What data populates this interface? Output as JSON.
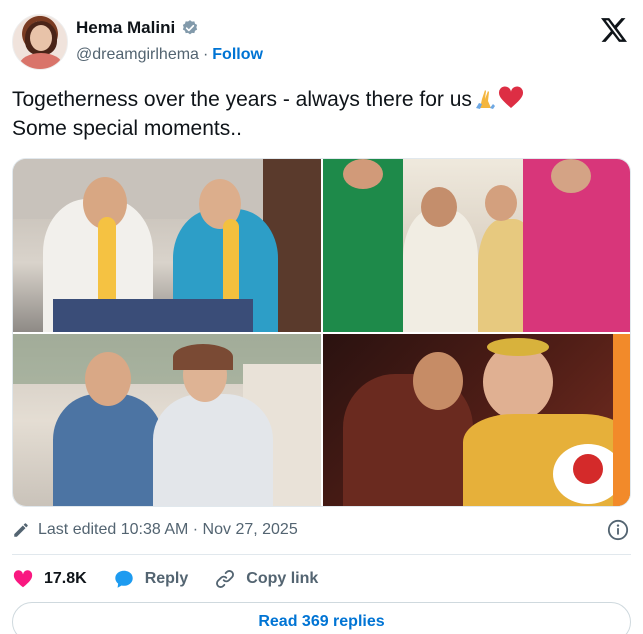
{
  "author": {
    "name": "Hema Malini",
    "handle": "@dreamgirlhema",
    "separator": "·",
    "follow_label": "Follow"
  },
  "tweet": {
    "text": "Togetherness over the years - always there for us",
    "text_line2": "Some special moments.."
  },
  "meta": {
    "edited_label": "Last edited 10:38 AM · Nov 27, 2025"
  },
  "actions": {
    "likes": "17.8K",
    "reply_label": "Reply",
    "copy_label": "Copy link"
  },
  "read_replies_label": "Read 369 replies",
  "icons": [
    "verified-badge-icon",
    "x-logo-icon",
    "folded-hands-icon",
    "red-heart-icon",
    "edit-pencil-icon",
    "info-icon",
    "heart-icon",
    "reply-bubble-icon",
    "link-icon"
  ],
  "colors": {
    "accent": "#0074d4",
    "like": "#f91880",
    "text": "#0f1419",
    "muted": "#536471"
  }
}
